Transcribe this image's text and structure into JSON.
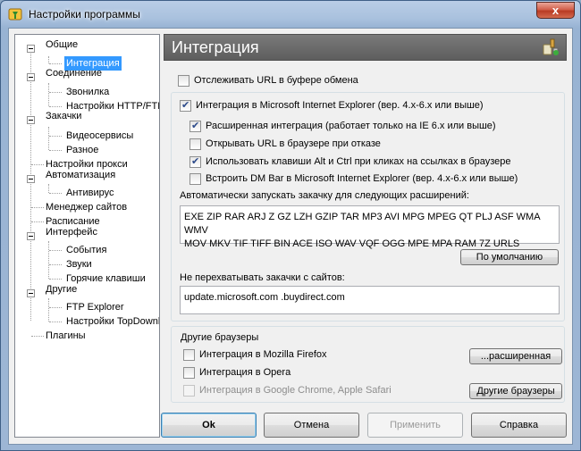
{
  "window": {
    "title": "Настройки программы",
    "close_glyph": "x"
  },
  "tree": {
    "items": [
      {
        "label": "Общие"
      },
      {
        "label": "Интеграция",
        "selected": true
      },
      {
        "label": "Соединение"
      },
      {
        "label": "Звонилка"
      },
      {
        "label": "Настройки HTTP/FTP"
      },
      {
        "label": "Закачки"
      },
      {
        "label": "Видеосервисы"
      },
      {
        "label": "Разное"
      },
      {
        "label": "Настройки прокси"
      },
      {
        "label": "Автоматизация"
      },
      {
        "label": "Антивирус"
      },
      {
        "label": "Менеджер сайтов"
      },
      {
        "label": "Расписание"
      },
      {
        "label": "Интерфейс"
      },
      {
        "label": "События"
      },
      {
        "label": "Звуки"
      },
      {
        "label": "Горячие клавиши"
      },
      {
        "label": "Другие"
      },
      {
        "label": "FTP Explorer"
      },
      {
        "label": "Настройки TopDownloads"
      },
      {
        "label": "Плагины"
      }
    ]
  },
  "panel": {
    "title": "Интеграция",
    "header_icon": "integration-plug-icon",
    "clipboard_cb": {
      "label": "Отслеживать URL в буфере обмена",
      "checked": false
    },
    "ie_group": {
      "main_cb": {
        "label": "Интеграция в Microsoft Internet Explorer (вер. 4.x-6.x или выше)",
        "checked": true
      },
      "advanced_cb": {
        "label": "Расширенная интеграция (работает только на IE 6.x или выше)",
        "checked": true
      },
      "open_on_fail_cb": {
        "label": "Открывать URL в браузере при отказе",
        "checked": false
      },
      "alt_ctrl_cb": {
        "label": "Использовать клавиши Alt и Ctrl при кликах на ссылках в браузере",
        "checked": true
      },
      "dm_bar_cb": {
        "label": "Встроить DM Bar в Microsoft Internet Explorer (вер. 4.x-6.x или выше)",
        "checked": false
      },
      "extensions_label": "Автоматически запускать закачку для следующих расширений:",
      "extensions_line1": "EXE ZIP RAR ARJ Z GZ LZH GZIP TAR MP3 AVI MPG MPEG QT PLJ ASF WMA WMV",
      "extensions_line2": "MOV MKV TIF TIFF BIN ACE ISO WAV VQF OGG MPE MPA RAM 7Z URLS",
      "defaults_button": "По умолчанию",
      "sites_label": "Не перехватывать закачки с сайтов:",
      "sites_value": "update.microsoft.com .buydirect.com"
    },
    "other_browsers": {
      "title": "Другие браузеры",
      "firefox_cb": {
        "label": "Интеграция в Mozilla Firefox",
        "checked": false
      },
      "opera_cb": {
        "label": "Интеграция в Opera",
        "checked": false
      },
      "chrome_cb": {
        "label": "Интеграция в Google Chrome, Apple Safari",
        "checked": false,
        "disabled": true
      },
      "advanced_button": "...расширенная",
      "other_button": "Другие браузеры"
    }
  },
  "buttons": {
    "ok": "Ok",
    "cancel": "Отмена",
    "apply": "Применить",
    "help": "Справка"
  },
  "colors": {
    "selection": "#3399ff",
    "header": "#6b6b6b",
    "checkmark": "#2c4a8a"
  }
}
